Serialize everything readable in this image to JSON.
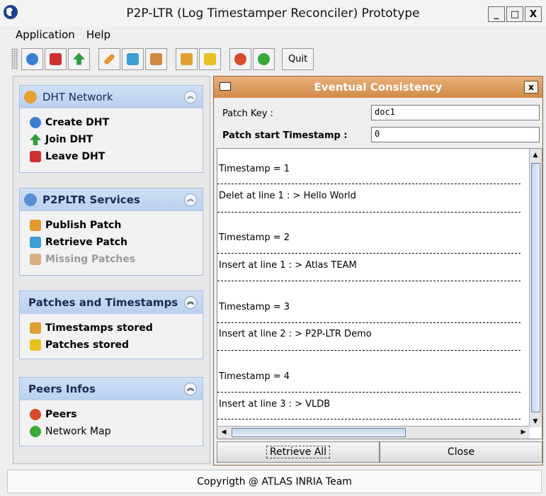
{
  "window": {
    "title": "P2P-LTR (Log Timestamper Reconciler) Prototype",
    "minimize": "_",
    "maximize": "□",
    "close": "X"
  },
  "menu": [
    "Application",
    "Help"
  ],
  "toolbar": {
    "buttons": [
      "gear-icon",
      "megaphone-icon",
      "arrow-up-icon",
      "pencil-icon",
      "picture-icon",
      "puzzle-icon",
      "folder-icon",
      "notes-icon",
      "globe-icon",
      "flower-icon"
    ],
    "quit_label": "Quit"
  },
  "groups": [
    {
      "title": "DHT Network",
      "items": [
        {
          "label": "Create DHT",
          "icon": "gear-icon",
          "color": "#3a7fd5"
        },
        {
          "label": "Join DHT",
          "icon": "arrow-up-icon",
          "color": "#2e9e3e"
        },
        {
          "label": "Leave DHT",
          "icon": "megaphone-icon",
          "color": "#d03030"
        }
      ]
    },
    {
      "title": "P2PLTR Services",
      "items": [
        {
          "label": "Publish Patch",
          "icon": "pencil-icon",
          "color": "#e09a30"
        },
        {
          "label": "Retrieve Patch",
          "icon": "picture-icon",
          "color": "#3a9ed5"
        },
        {
          "label": "Missing Patches",
          "icon": "puzzle-icon",
          "color": "#d08a40"
        }
      ]
    },
    {
      "title": "Patches and Timestamps",
      "items": [
        {
          "label": "Timestamps stored",
          "icon": "folder-icon",
          "color": "#e0a030"
        },
        {
          "label": "Patches stored",
          "icon": "notes-icon",
          "color": "#e8c020"
        }
      ]
    },
    {
      "title": "Peers Infos",
      "items": [
        {
          "label": "Peers",
          "icon": "globe-icon",
          "color": "#d84a2a"
        },
        {
          "label": "Network Map",
          "icon": "flower-icon",
          "color": "#3aa83a"
        }
      ]
    }
  ],
  "dialog": {
    "title": "Eventual Consistency",
    "close": "x",
    "patch_key_label": "Patch Key :",
    "patch_key_value": "doc1",
    "patch_ts_label": "Patch start Timestamp :",
    "patch_ts_value": "0",
    "entries": [
      {
        "timestamp": "Timestamp = 1",
        "op": "Delet at line 1 : > Hello World"
      },
      {
        "timestamp": "Timestamp = 2",
        "op": "Insert at line 1 : > Atlas TEAM"
      },
      {
        "timestamp": "Timestamp = 3",
        "op": "Insert at line 2 : > P2P-LTR Demo"
      },
      {
        "timestamp": "Timestamp = 4",
        "op": "Insert at line 3 : > VLDB"
      }
    ],
    "retrieve_all_label": "Retrieve All",
    "close_label": "Close"
  },
  "footer": "Copyrigth @ ATLAS INRIA Team",
  "colors": {
    "accent": "#cf8a4a",
    "group_header": "#c3d7f1"
  }
}
